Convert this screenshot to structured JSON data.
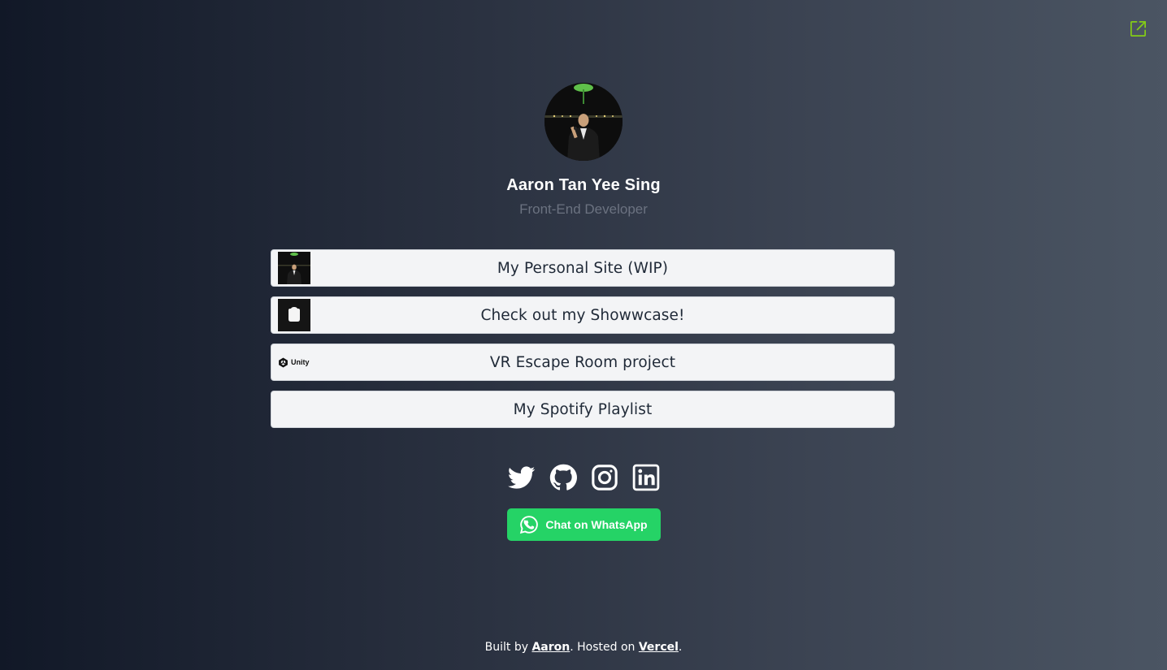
{
  "profile": {
    "name": "Aaron Tan Yee Sing",
    "role": "Front-End Developer",
    "avatar_icon": "person-photo"
  },
  "links": [
    {
      "label": "My Personal Site (WIP)",
      "thumb": "person-photo"
    },
    {
      "label": "Check out my Showwcase!",
      "thumb": "showwcase-logo"
    },
    {
      "label": "VR Escape Room project",
      "thumb": "unity-logo",
      "thumb_text": "Unity"
    },
    {
      "label": "My Spotify Playlist",
      "thumb": ""
    }
  ],
  "socials": [
    "twitter-icon",
    "github-icon",
    "instagram-icon",
    "linkedin-icon"
  ],
  "whatsapp": {
    "label": "Chat on WhatsApp",
    "color": "#25d366"
  },
  "footer": {
    "prefix": "Built by ",
    "author": "Aaron",
    "middle": ". Hosted on ",
    "host": "Vercel",
    "suffix": "."
  },
  "colors": {
    "accent": "#84cc16",
    "card_bg": "#f3f4f6",
    "muted": "#6b7280"
  }
}
